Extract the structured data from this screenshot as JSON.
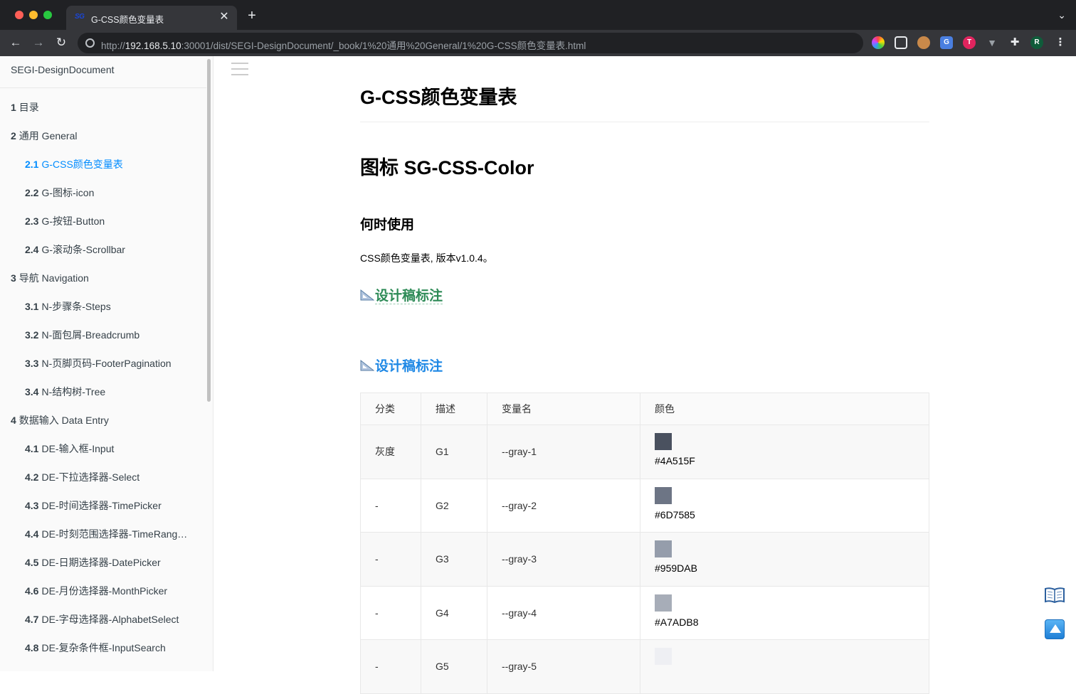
{
  "browser": {
    "tab_title": "G-CSS颜色变量表",
    "tab_favicon": "SG",
    "url_prefix": "http://",
    "url_host": "192.168.5.10",
    "url_rest": ":30001/dist/SEGI-DesignDocument/_book/1%20通用%20General/1%20G-CSS颜色变量表.html",
    "profile_initial": "R"
  },
  "sidebar": {
    "book_title": "SEGI-DesignDocument",
    "items": [
      {
        "num": "1",
        "label": "目录",
        "level": 1
      },
      {
        "num": "2",
        "label": "通用 General",
        "level": 1
      },
      {
        "num": "2.1",
        "label": "G-CSS颜色变量表",
        "level": 2,
        "active": true
      },
      {
        "num": "2.2",
        "label": "G-图标-icon",
        "level": 2
      },
      {
        "num": "2.3",
        "label": "G-按钮-Button",
        "level": 2
      },
      {
        "num": "2.4",
        "label": "G-滚动条-Scrollbar",
        "level": 2
      },
      {
        "num": "3",
        "label": "导航 Navigation",
        "level": 1
      },
      {
        "num": "3.1",
        "label": "N-步骤条-Steps",
        "level": 2
      },
      {
        "num": "3.2",
        "label": "N-面包屑-Breadcrumb",
        "level": 2
      },
      {
        "num": "3.3",
        "label": "N-页脚页码-FooterPagination",
        "level": 2
      },
      {
        "num": "3.4",
        "label": "N-结构树-Tree",
        "level": 2
      },
      {
        "num": "4",
        "label": "数据输入 Data Entry",
        "level": 1
      },
      {
        "num": "4.1",
        "label": "DE-输入框-Input",
        "level": 2
      },
      {
        "num": "4.2",
        "label": "DE-下拉选择器-Select",
        "level": 2
      },
      {
        "num": "4.3",
        "label": "DE-时间选择器-TimePicker",
        "level": 2
      },
      {
        "num": "4.4",
        "label": "DE-时刻范围选择器-TimeRang…",
        "level": 2
      },
      {
        "num": "4.5",
        "label": "DE-日期选择器-DatePicker",
        "level": 2
      },
      {
        "num": "4.6",
        "label": "DE-月份选择器-MonthPicker",
        "level": 2
      },
      {
        "num": "4.7",
        "label": "DE-字母选择器-AlphabetSelect",
        "level": 2
      },
      {
        "num": "4.8",
        "label": "DE-复杂条件框-InputSearch",
        "level": 2
      }
    ]
  },
  "content": {
    "h1": "G-CSS颜色变量表",
    "h1b": "图标 SG-CSS-Color",
    "h3": "何时使用",
    "para": "CSS颜色变量表, 版本v1.0.4。",
    "anchor1": "设计稿标注",
    "anchor2": "设计稿标注",
    "table": {
      "headers": [
        "分类",
        "描述",
        "变量名",
        "颜色"
      ],
      "rows": [
        {
          "category": "灰度",
          "desc": "G1",
          "var": "--gray-1",
          "hex": "#4A515F",
          "color": "#4A515F"
        },
        {
          "category": "-",
          "desc": "G2",
          "var": "--gray-2",
          "hex": "#6D7585",
          "color": "#6D7585"
        },
        {
          "category": "-",
          "desc": "G3",
          "var": "--gray-3",
          "hex": "#959DAB",
          "color": "#959DAB"
        },
        {
          "category": "-",
          "desc": "G4",
          "var": "--gray-4",
          "hex": "#A7ADB8",
          "color": "#A7ADB8"
        },
        {
          "category": "-",
          "desc": "G5",
          "var": "--gray-5",
          "hex": "",
          "color": "#EEEFF3"
        }
      ]
    }
  },
  "colors": {
    "active_link": "#008cff",
    "anchor_green": "#2e8b57",
    "anchor_blue": "#1e88e5"
  }
}
